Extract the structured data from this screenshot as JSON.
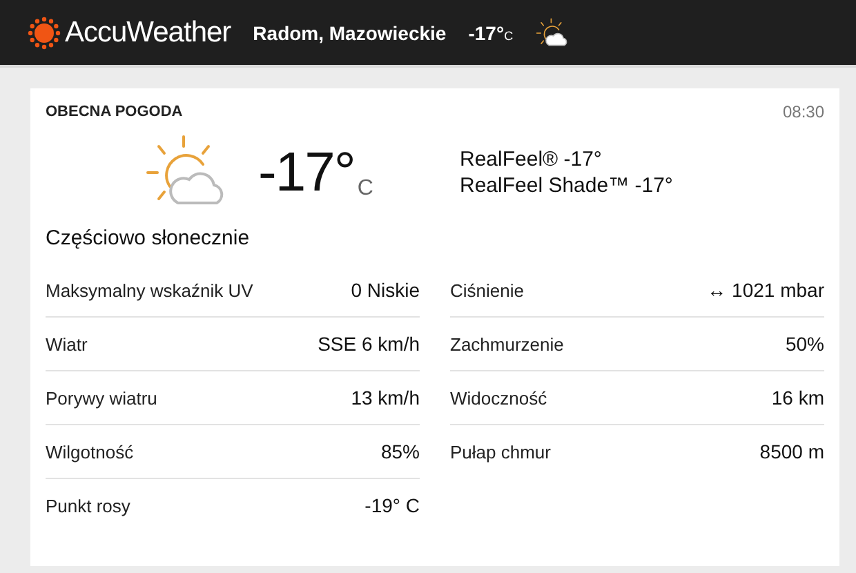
{
  "header": {
    "brand": "AccuWeather",
    "location": "Radom, Mazowieckie",
    "temperature": "-17°",
    "unit": "C"
  },
  "current": {
    "title": "OBECNA POGODA",
    "time": "08:30",
    "temperature": "-17°",
    "unit": "C",
    "realfeel": [
      "RealFeel® -17°",
      "RealFeel Shade™ -17°"
    ],
    "condition": "Częściowo słonecznie"
  },
  "details": [
    [
      {
        "label": "Maksymalny wskaźnik UV",
        "value": "0 Niskie"
      },
      {
        "label": "Wiatr",
        "value": "SSE 6 km/h"
      },
      {
        "label": "Porywy wiatru",
        "value": "13 km/h"
      },
      {
        "label": "Wilgotność",
        "value": "85%"
      },
      {
        "label": "Punkt rosy",
        "value": "-19° C"
      }
    ],
    [
      {
        "label": "Ciśnienie",
        "value": "↔ 1021 mbar"
      },
      {
        "label": "Zachmurzenie",
        "value": "50%"
      },
      {
        "label": "Widoczność",
        "value": "16 km"
      },
      {
        "label": "Pułap chmur",
        "value": "8500 m"
      }
    ]
  ]
}
